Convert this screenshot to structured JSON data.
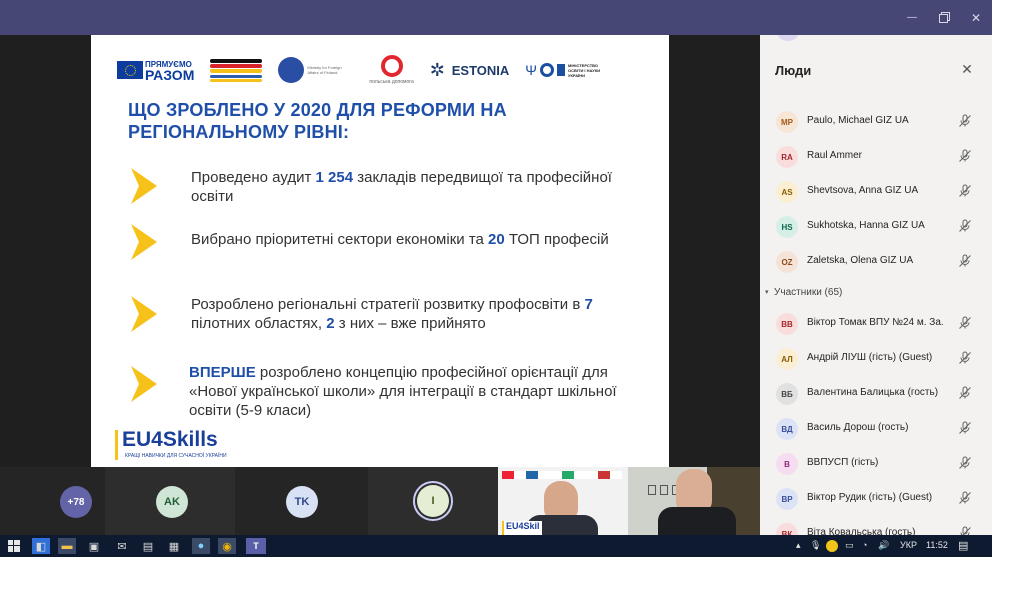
{
  "window": {
    "minimize": "—",
    "close": "✕"
  },
  "slide": {
    "logos": {
      "eu_line1": "ПРЯМУЄМО",
      "eu_line2": "РАЗОМ",
      "fi_text": "Ministry for Foreign Affairs of Finland",
      "pl_text": "польська допомога",
      "ee_text": "ESTONIA",
      "mon_text": "МІНІСТЕРСТВО ОСВІТИ І НАУКИ УКРАЇНИ"
    },
    "title": "ЩО ЗРОБЛЕНО У 2020 ДЛЯ РЕФОРМИ НА РЕГІОНАЛЬНОМУ РІВНІ:",
    "bullets": [
      {
        "pre": "Проведено аудит ",
        "bold": "1 254",
        "post": " закладів передвищої та професійної освіти"
      },
      {
        "pre": "Вибрано пріоритетні сектори економіки та ",
        "bold": "20",
        "post": " ТОП професій"
      },
      {
        "pre": "Розроблено регіональні стратегії розвитку профосвіти в ",
        "bold": "7",
        "post": " пілотних областях, ",
        "bold2": "2",
        "post2": " з них – вже прийнято"
      },
      {
        "pre": "",
        "bold": "ВПЕРШЕ",
        "post": " розроблено концепцію професійної орієнтації для «Нової української школи» для інтеграції в стандарт шкільної освіти (5-9 класи)"
      }
    ],
    "footer_logo": "EU4Skills",
    "footer_sub": "КРАЩІ НАВИЧКИ ДЛЯ СУЧАСНОЇ УКРАЇНИ"
  },
  "thumbs": {
    "more_count": "+78",
    "ak": "AK",
    "tk": "TK",
    "i": "I",
    "video_label": "EU4Skil"
  },
  "panel": {
    "title": "Люди",
    "section_label": "Участники (65)",
    "organizers": [
      {
        "initials": "MP",
        "name": "Paulo, Michael GIZ UA",
        "color": "#f7e5d6",
        "text": "#a45a1b"
      },
      {
        "initials": "RA",
        "name": "Raul Ammer",
        "color": "#f9dddd",
        "text": "#a4262c"
      },
      {
        "initials": "AS",
        "name": "Shevtsova, Anna GIZ UA",
        "color": "#fbefd3",
        "text": "#8a5a00"
      },
      {
        "initials": "HS",
        "name": "Sukhotska, Hanna GIZ UA",
        "color": "#d6efe6",
        "text": "#0b6a4c"
      },
      {
        "initials": "OZ",
        "name": "Zaletska, Olena GIZ UA",
        "color": "#f6e3d7",
        "text": "#8e4a18"
      }
    ],
    "participants": [
      {
        "initials": "ВВ",
        "name": "Віктор Томак ВПУ №24 м. За.",
        "color": "#f9dddd",
        "text": "#a4262c"
      },
      {
        "initials": "АЛ",
        "name": "Андрій ЛІУШ (гість) (Guest)",
        "color": "#fbefd3",
        "text": "#8a5a00"
      },
      {
        "initials": "ВБ",
        "name": "Валентина Балицька (гость)",
        "color": "#e1e1e1",
        "text": "#444444"
      },
      {
        "initials": "ВД",
        "name": "Василь Дорош (гость)",
        "color": "#dde3f6",
        "text": "#3a4f9a"
      },
      {
        "initials": "В",
        "name": "ВВПУСП (гість)",
        "color": "#f5dcf0",
        "text": "#8c2c7a"
      },
      {
        "initials": "ВР",
        "name": "Віктор Рудик (гість) (Guest)",
        "color": "#dde3f6",
        "text": "#3a4f9a"
      },
      {
        "initials": "ВК",
        "name": "Віта Ковальська (гость)",
        "color": "#f9dddd",
        "text": "#a4262c"
      }
    ]
  },
  "taskbar": {
    "lang": "УКР",
    "time": "11:52"
  }
}
